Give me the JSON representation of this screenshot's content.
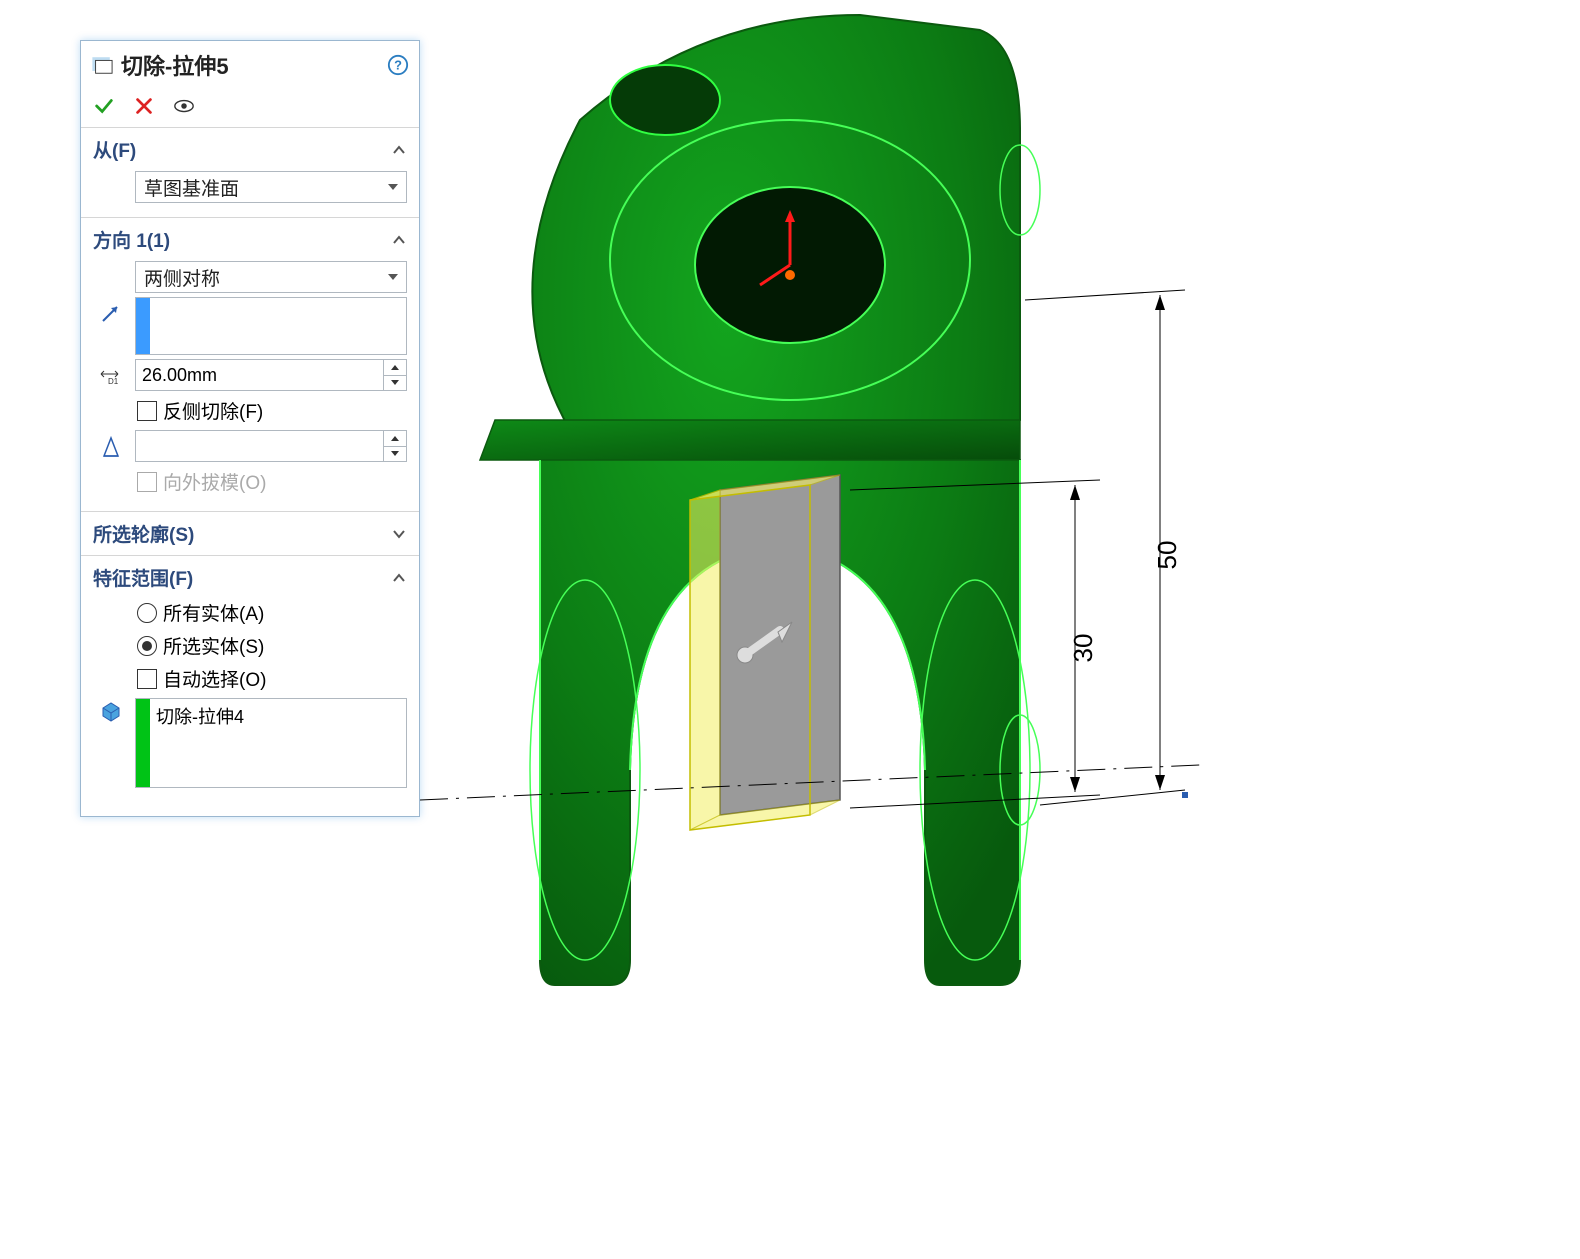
{
  "panel": {
    "title": "切除-拉伸5",
    "sections": {
      "from": {
        "header": "从(F)",
        "combo_value": "草图基准面"
      },
      "dir1": {
        "header": "方向 1(1)",
        "end_condition": "两侧对称",
        "depth": "26.00mm",
        "flip_cut_label": "反侧切除(F)",
        "draft_value": "",
        "draft_outward_label": "向外拔模(O)"
      },
      "contours": {
        "header": "所选轮廓(S)"
      },
      "scope": {
        "header": "特征范围(F)",
        "opt_all": "所有实体(A)",
        "opt_selected": "所选实体(S)",
        "auto_select": "自动选择(O)",
        "selected_item": "切除-拉伸4"
      }
    }
  },
  "viewport": {
    "dimensions": {
      "d50": "50",
      "d30": "30"
    }
  },
  "colors": {
    "model_fill": "#0f8a17",
    "model_highlight": "#6fff6f",
    "selection_yellow": "#f3ef63",
    "edge_green": "#00c316"
  }
}
